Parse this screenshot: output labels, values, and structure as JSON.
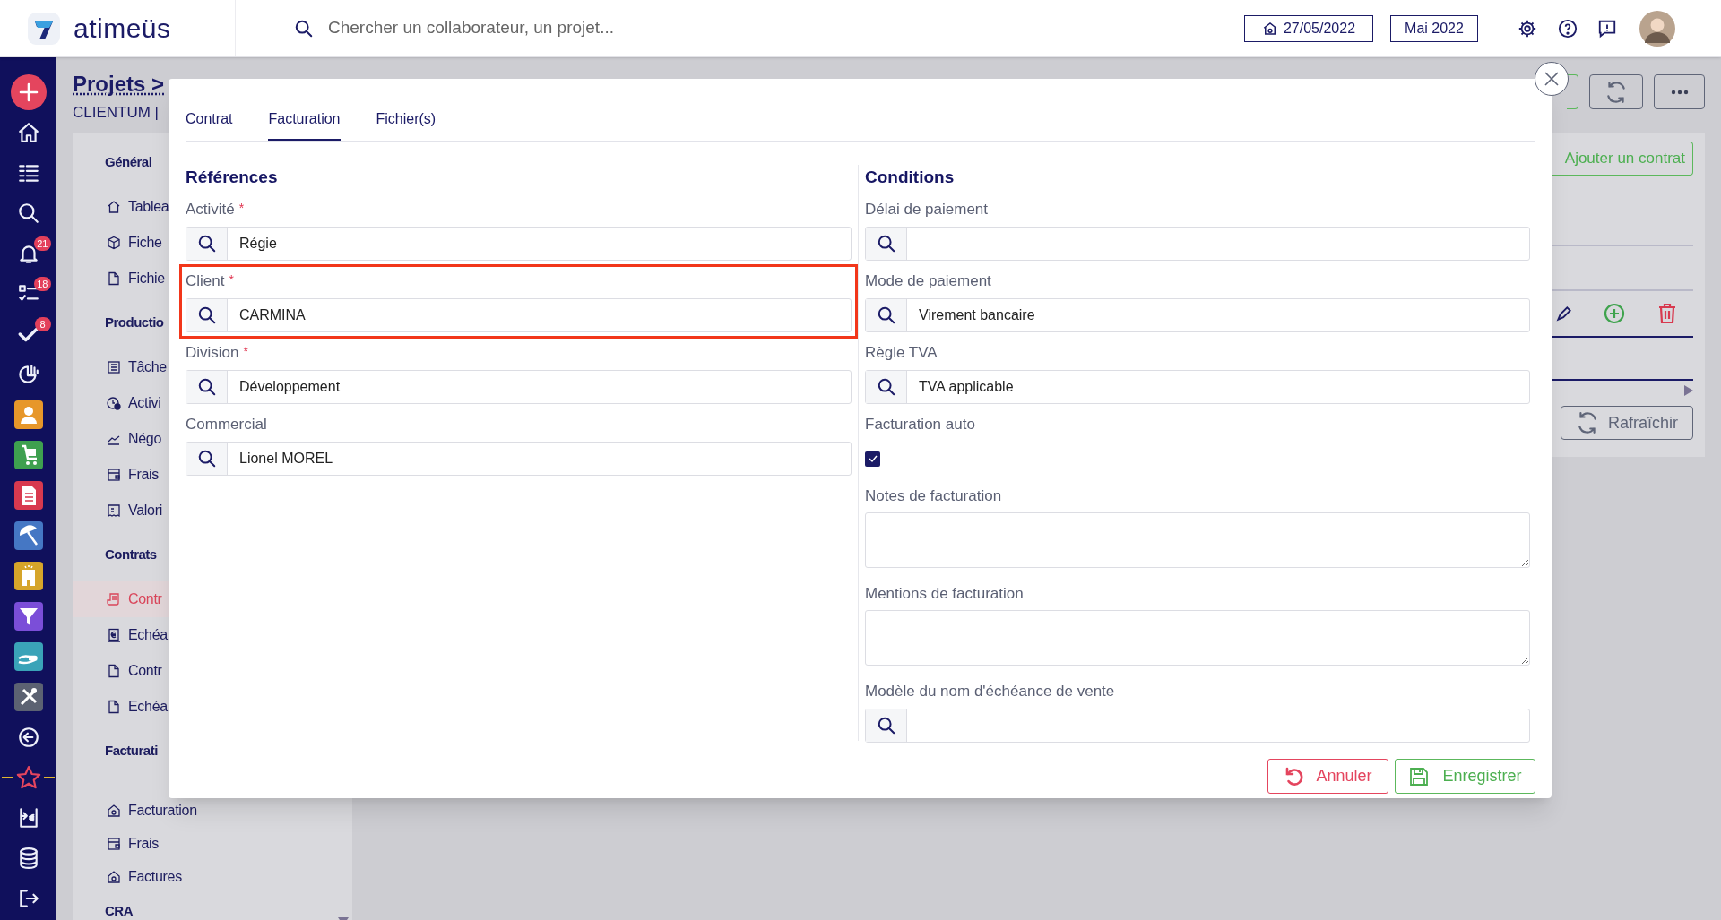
{
  "app": {
    "logo_text": "atimeüs",
    "search": {
      "placeholder": "Chercher un collaborateur, un projet..."
    },
    "date_button": "27/05/2022",
    "period_button": "Mai 2022"
  },
  "notification_badges": {
    "alerts": "21",
    "tasks": "18",
    "validations": "8"
  },
  "page": {
    "breadcrumb": "Projets >",
    "subtitle": "CLIENTUM |"
  },
  "project_menu": [
    {
      "title": "Général",
      "items": [
        {
          "label": "Tablea",
          "selected": false
        },
        {
          "label": "Fiche",
          "selected": false
        },
        {
          "label": "Fichie",
          "selected": false
        }
      ]
    },
    {
      "title": "Productio",
      "items": [
        {
          "label": "Tâche",
          "selected": false
        },
        {
          "label": "Activi",
          "selected": false
        },
        {
          "label": "Négo",
          "selected": false
        },
        {
          "label": "Frais",
          "selected": false
        },
        {
          "label": "Valori",
          "selected": false
        }
      ]
    },
    {
      "title": "Contrats",
      "items": [
        {
          "label": "Contr",
          "selected": true
        },
        {
          "label": "Echéa",
          "selected": false
        },
        {
          "label": "Contr",
          "selected": false
        },
        {
          "label": "Echéa",
          "selected": false
        }
      ]
    },
    {
      "title": "Facturati",
      "items": [
        {
          "label": "Facturation",
          "selected": false
        },
        {
          "label": "Frais",
          "selected": false
        },
        {
          "label": "Factures",
          "selected": false
        }
      ]
    },
    {
      "title": "CRA"
    }
  ],
  "contracts_panel": {
    "add_button": "Ajouter un contrat",
    "refresh_button": "Rafraîchir"
  },
  "dialog": {
    "tabs": [
      {
        "label": "Contrat",
        "selected": false
      },
      {
        "label": "Facturation",
        "selected": true
      },
      {
        "label": "Fichier(s)",
        "selected": false
      }
    ],
    "sections": [
      {
        "title": "Références",
        "fields": [
          {
            "kind": "lookup",
            "label": "Activité",
            "required_mark": "*",
            "value": "Régie"
          },
          {
            "kind": "lookup",
            "label": "Client",
            "required_mark": "*",
            "value": "CARMINA",
            "highlighted": true
          },
          {
            "kind": "lookup",
            "label": "Division",
            "required_mark": "*",
            "value": "Développement"
          },
          {
            "kind": "lookup",
            "label": "Commercial",
            "value": "Lionel MOREL"
          }
        ]
      },
      {
        "title": "Conditions",
        "fields": [
          {
            "kind": "lookup",
            "label": "Délai de paiement"
          },
          {
            "kind": "lookup",
            "label": "Mode de paiement",
            "value": "Virement bancaire"
          },
          {
            "kind": "lookup",
            "label": "Règle TVA",
            "value": "TVA applicable"
          },
          {
            "kind": "checkbox",
            "label": "Facturation auto",
            "checked": true
          },
          {
            "kind": "textarea",
            "label": "Notes de facturation"
          },
          {
            "kind": "textarea",
            "label": "Mentions de facturation"
          },
          {
            "kind": "lookup",
            "label": "Modèle du nom d'échéance de vente"
          }
        ]
      }
    ],
    "buttons": [
      {
        "kind": "cancel",
        "label": "Annuler"
      },
      {
        "kind": "save",
        "label": "Enregistrer"
      }
    ]
  }
}
